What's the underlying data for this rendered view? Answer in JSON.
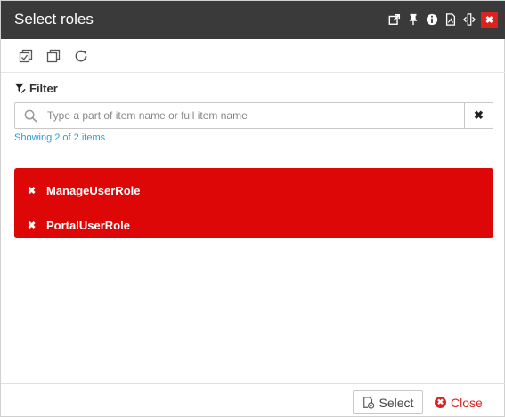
{
  "dialog": {
    "title": "Select roles",
    "title_icons": [
      "popout-icon",
      "pin-icon",
      "info-icon",
      "pdf-icon",
      "resize-horizontal-icon",
      "close-icon"
    ],
    "close_symbol": "✖"
  },
  "toolbar": {
    "buttons": [
      "select-all-icon",
      "deselect-all-icon",
      "refresh-icon"
    ]
  },
  "filter": {
    "label": "Filter",
    "placeholder": "Type a part of item name or full item name",
    "value": "",
    "clear_symbol": "✖",
    "showing_text": "Showing 2 of 2 items"
  },
  "selected_items": [
    {
      "remove_symbol": "✖",
      "label": "ManageUserRole"
    },
    {
      "remove_symbol": "✖",
      "label": "PortalUserRole"
    }
  ],
  "footer": {
    "select_label": "Select",
    "close_label": "Close",
    "close_symbol": "✖"
  },
  "colors": {
    "titlebar": "#3a3a3a",
    "selected_background": "#dd0707",
    "accent_blue": "#2a9fd6",
    "close_red": "#d9231e"
  }
}
